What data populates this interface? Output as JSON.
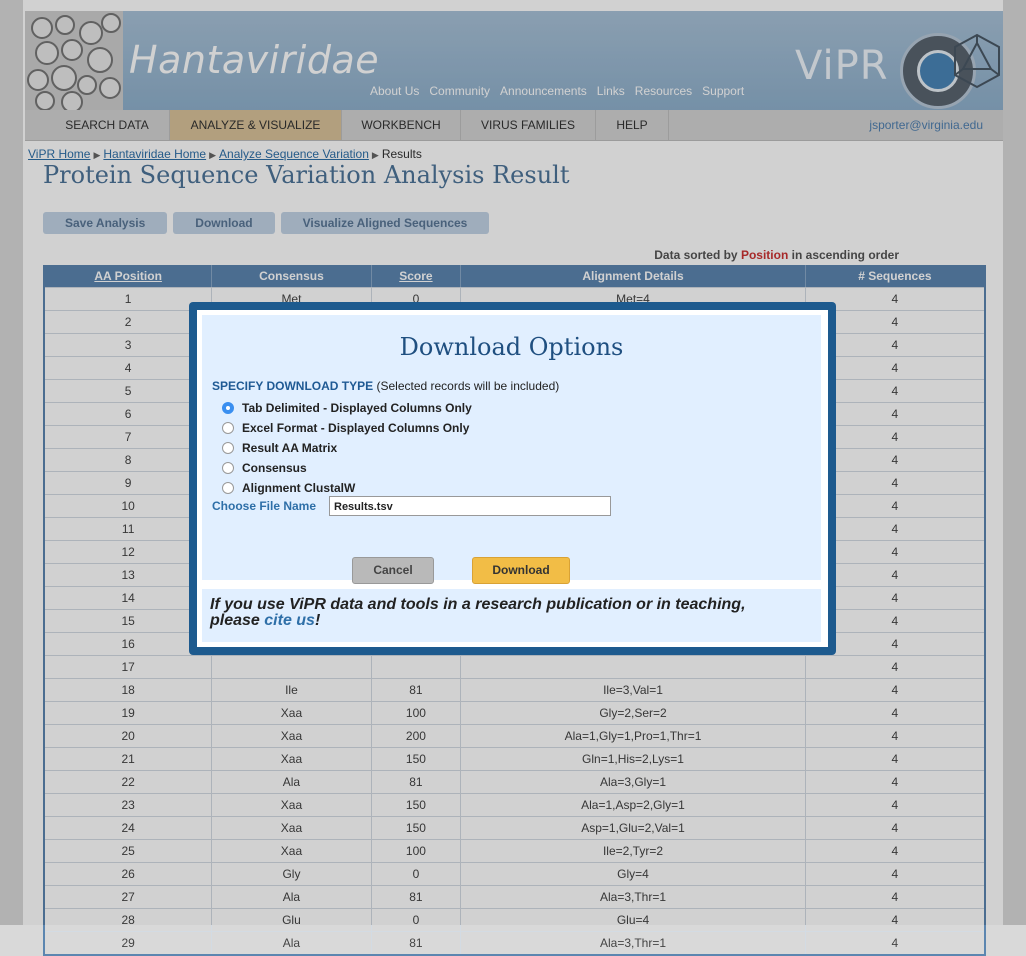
{
  "banner": {
    "virus_family": "Hantaviridae",
    "logo_text": "ViPR",
    "links": [
      "About Us",
      "Community",
      "Announcements",
      "Links",
      "Resources",
      "Support"
    ]
  },
  "nav": {
    "items": [
      "SEARCH DATA",
      "ANALYZE & VISUALIZE",
      "WORKBENCH",
      "VIRUS FAMILIES",
      "HELP"
    ],
    "active_index": 1,
    "user": "jsporter@virginia.edu"
  },
  "breadcrumb": {
    "items": [
      "ViPR Home",
      "Hantaviridae Home",
      "Analyze Sequence Variation"
    ],
    "current": "Results"
  },
  "page_title": "Protein Sequence Variation Analysis Result",
  "actions": {
    "save": "Save Analysis",
    "download": "Download",
    "visualize": "Visualize Aligned Sequences"
  },
  "sort_note": {
    "prefix": "Data sorted by",
    "field": "Position",
    "suffix": "in ascending order"
  },
  "table": {
    "headers": [
      "AA Position",
      "Consensus",
      "Score",
      "Alignment Details",
      "# Sequences"
    ],
    "rows": [
      [
        "1",
        "Met",
        "0",
        "Met=4",
        "4"
      ],
      [
        "2",
        "",
        "",
        "",
        "4"
      ],
      [
        "3",
        "",
        "",
        "",
        "4"
      ],
      [
        "4",
        "",
        "",
        "",
        "4"
      ],
      [
        "5",
        "",
        "",
        "",
        "4"
      ],
      [
        "6",
        "",
        "",
        "",
        "4"
      ],
      [
        "7",
        "",
        "",
        "",
        "4"
      ],
      [
        "8",
        "",
        "",
        "",
        "4"
      ],
      [
        "9",
        "",
        "",
        "",
        "4"
      ],
      [
        "10",
        "",
        "",
        "",
        "4"
      ],
      [
        "11",
        "",
        "",
        "",
        "4"
      ],
      [
        "12",
        "",
        "",
        "",
        "4"
      ],
      [
        "13",
        "",
        "",
        "",
        "4"
      ],
      [
        "14",
        "",
        "",
        "",
        "4"
      ],
      [
        "15",
        "",
        "",
        "",
        "4"
      ],
      [
        "16",
        "",
        "",
        "",
        "4"
      ],
      [
        "17",
        "",
        "",
        "",
        "4"
      ],
      [
        "18",
        "Ile",
        "81",
        "Ile=3,Val=1",
        "4"
      ],
      [
        "19",
        "Xaa",
        "100",
        "Gly=2,Ser=2",
        "4"
      ],
      [
        "20",
        "Xaa",
        "200",
        "Ala=1,Gly=1,Pro=1,Thr=1",
        "4"
      ],
      [
        "21",
        "Xaa",
        "150",
        "Gln=1,His=2,Lys=1",
        "4"
      ],
      [
        "22",
        "Ala",
        "81",
        "Ala=3,Gly=1",
        "4"
      ],
      [
        "23",
        "Xaa",
        "150",
        "Ala=1,Asp=2,Gly=1",
        "4"
      ],
      [
        "24",
        "Xaa",
        "150",
        "Asp=1,Glu=2,Val=1",
        "4"
      ],
      [
        "25",
        "Xaa",
        "100",
        "Ile=2,Tyr=2",
        "4"
      ],
      [
        "26",
        "Gly",
        "0",
        "Gly=4",
        "4"
      ],
      [
        "27",
        "Ala",
        "81",
        "Ala=3,Thr=1",
        "4"
      ],
      [
        "28",
        "Glu",
        "0",
        "Glu=4",
        "4"
      ],
      [
        "29",
        "Ala",
        "81",
        "Ala=3,Thr=1",
        "4"
      ]
    ]
  },
  "modal": {
    "title": "Download Options",
    "spec_label": "SPECIFY DOWNLOAD TYPE",
    "spec_note": "(Selected records will be included)",
    "options": [
      "Tab Delimited - Displayed Columns Only",
      "Excel Format - Displayed Columns Only",
      "Result AA Matrix",
      "Consensus",
      "Alignment ClustalW"
    ],
    "selected_index": 0,
    "filename_label": "Choose File Name",
    "filename_value": "Results.tsv",
    "cancel": "Cancel",
    "download": "Download",
    "footer_pre": "If you use ViPR data and tools in a research publication or in teaching, please",
    "footer_link": "cite us",
    "footer_post": "!"
  },
  "colors": {
    "accent": "#1d5a8e",
    "table_header": "#5c86b0",
    "download_button": "#f2bd46",
    "active_nav": "#d9c39a"
  }
}
